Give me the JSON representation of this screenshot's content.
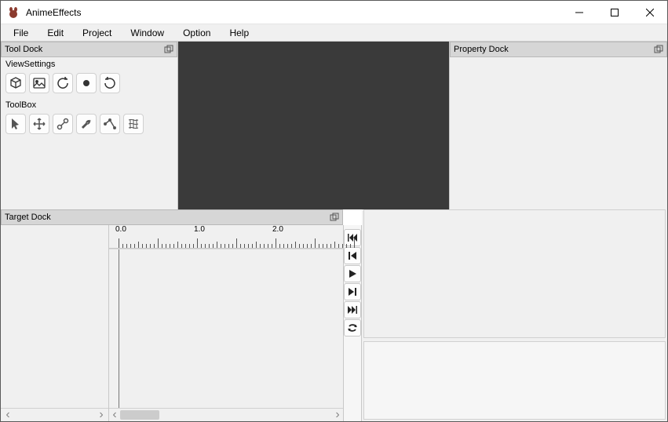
{
  "app": {
    "title": "AnimeEffects"
  },
  "menubar": [
    "File",
    "Edit",
    "Project",
    "Window",
    "Option",
    "Help"
  ],
  "toolDock": {
    "title": "Tool Dock",
    "viewSettingsLabel": "ViewSettings",
    "toolBoxLabel": "ToolBox"
  },
  "propertyDock": {
    "title": "Property Dock"
  },
  "targetDock": {
    "title": "Target Dock"
  },
  "timeline": {
    "labels": [
      "0.0",
      "1.0",
      "2.0"
    ]
  }
}
